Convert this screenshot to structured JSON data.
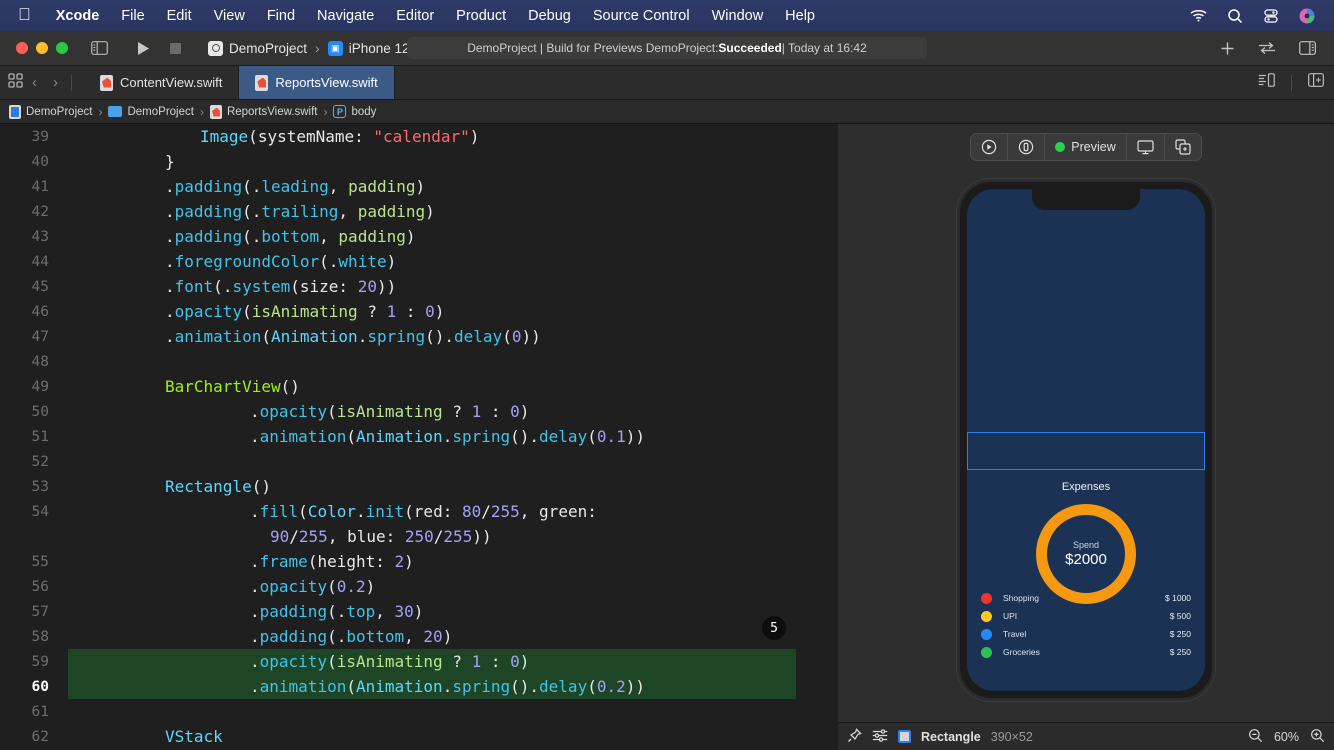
{
  "menubar": {
    "apple_icon": "apple-logo-icon",
    "items": [
      {
        "label": "Xcode",
        "bold": true
      },
      {
        "label": "File",
        "bold": false
      },
      {
        "label": "Edit",
        "bold": false
      },
      {
        "label": "View",
        "bold": false
      },
      {
        "label": "Find",
        "bold": false
      },
      {
        "label": "Navigate",
        "bold": false
      },
      {
        "label": "Editor",
        "bold": false
      },
      {
        "label": "Product",
        "bold": false
      },
      {
        "label": "Debug",
        "bold": false
      },
      {
        "label": "Source Control",
        "bold": false
      },
      {
        "label": "Window",
        "bold": false
      },
      {
        "label": "Help",
        "bold": false
      }
    ],
    "status_icons": [
      "wifi-icon",
      "search-icon",
      "control-center-icon",
      "user-avatar-icon"
    ],
    "accent": "#2e3a68"
  },
  "toolbar": {
    "traffic_lights": [
      "close-button",
      "minimize-button",
      "zoom-button"
    ],
    "sidebar_toggle": "toggle-navigator-icon",
    "run_button": "run-icon",
    "stop_button": "stop-icon",
    "scheme_project": "DemoProject",
    "scheme_separator": "›",
    "scheme_device": "iPhone 12",
    "status": {
      "prefix": "DemoProject | Build for Previews DemoProject: ",
      "result": "Succeeded",
      "suffix": " | Today at 16:42"
    },
    "add_button": "plus-icon",
    "history_button": "code-review-icon",
    "inspector_toggle": "toggle-inspector-icon"
  },
  "tabbar": {
    "grid_icon": "tab-grid-icon",
    "back_arrow": "‹",
    "forward_arrow": "›",
    "tabs": [
      {
        "label": "ContentView.swift",
        "active": false,
        "icon": "swift-file-icon"
      },
      {
        "label": "ReportsView.swift",
        "active": true,
        "icon": "swift-file-icon"
      }
    ],
    "right_icons": [
      "minimap-icon",
      "add-editor-icon"
    ]
  },
  "breadcrumb": {
    "items": [
      {
        "label": "DemoProject",
        "icon": "xcode-project-icon"
      },
      {
        "label": "DemoProject",
        "icon": "folder-icon"
      },
      {
        "label": "ReportsView.swift",
        "icon": "swift-file-icon"
      },
      {
        "label": "body",
        "icon": "property-icon"
      }
    ],
    "separator": "›"
  },
  "editor": {
    "marker_badge": "5",
    "highlight_color": "#1d4526",
    "lines": [
      {
        "num": "39",
        "indent": 0,
        "tokens": [
          {
            "t": "Image",
            "c": "t"
          },
          {
            "t": "(",
            "c": "p"
          },
          {
            "t": "systemName",
            "c": "p"
          },
          {
            "t": ": ",
            "c": "p"
          },
          {
            "t": "\"calendar\"",
            "c": "s"
          },
          {
            "t": ")",
            "c": "p"
          }
        ],
        "hl": false
      },
      {
        "num": "40",
        "indent": 0,
        "tokens": [
          {
            "t": "}",
            "c": "p"
          }
        ],
        "hl": false,
        "dedent": true
      },
      {
        "num": "41",
        "indent": 0,
        "tokens": [
          {
            "t": ".",
            "c": "p"
          },
          {
            "t": "padding",
            "c": "f"
          },
          {
            "t": "(",
            "c": "p"
          },
          {
            "t": ".",
            "c": "p"
          },
          {
            "t": "leading",
            "c": "f"
          },
          {
            "t": ", ",
            "c": "p"
          },
          {
            "t": "padding",
            "c": "v"
          },
          {
            "t": ")",
            "c": "p"
          }
        ],
        "hl": false,
        "dedent": true
      },
      {
        "num": "42",
        "indent": 0,
        "tokens": [
          {
            "t": ".",
            "c": "p"
          },
          {
            "t": "padding",
            "c": "f"
          },
          {
            "t": "(",
            "c": "p"
          },
          {
            "t": ".",
            "c": "p"
          },
          {
            "t": "trailing",
            "c": "f"
          },
          {
            "t": ", ",
            "c": "p"
          },
          {
            "t": "padding",
            "c": "v"
          },
          {
            "t": ")",
            "c": "p"
          }
        ],
        "hl": false,
        "dedent": true
      },
      {
        "num": "43",
        "indent": 0,
        "tokens": [
          {
            "t": ".",
            "c": "p"
          },
          {
            "t": "padding",
            "c": "f"
          },
          {
            "t": "(",
            "c": "p"
          },
          {
            "t": ".",
            "c": "p"
          },
          {
            "t": "bottom",
            "c": "f"
          },
          {
            "t": ", ",
            "c": "p"
          },
          {
            "t": "padding",
            "c": "v"
          },
          {
            "t": ")",
            "c": "p"
          }
        ],
        "hl": false,
        "dedent": true
      },
      {
        "num": "44",
        "indent": 0,
        "tokens": [
          {
            "t": ".",
            "c": "p"
          },
          {
            "t": "foregroundColor",
            "c": "f"
          },
          {
            "t": "(",
            "c": "p"
          },
          {
            "t": ".",
            "c": "p"
          },
          {
            "t": "white",
            "c": "f"
          },
          {
            "t": ")",
            "c": "p"
          }
        ],
        "hl": false,
        "dedent": true
      },
      {
        "num": "45",
        "indent": 0,
        "tokens": [
          {
            "t": ".",
            "c": "p"
          },
          {
            "t": "font",
            "c": "f"
          },
          {
            "t": "(",
            "c": "p"
          },
          {
            "t": ".",
            "c": "p"
          },
          {
            "t": "system",
            "c": "f"
          },
          {
            "t": "(",
            "c": "p"
          },
          {
            "t": "size",
            "c": "p"
          },
          {
            "t": ": ",
            "c": "p"
          },
          {
            "t": "20",
            "c": "n"
          },
          {
            "t": "))",
            "c": "p"
          }
        ],
        "hl": false,
        "dedent": true
      },
      {
        "num": "46",
        "indent": 0,
        "tokens": [
          {
            "t": ".",
            "c": "p"
          },
          {
            "t": "opacity",
            "c": "f"
          },
          {
            "t": "(",
            "c": "p"
          },
          {
            "t": "isAnimating",
            "c": "v"
          },
          {
            "t": " ? ",
            "c": "p"
          },
          {
            "t": "1",
            "c": "n"
          },
          {
            "t": " : ",
            "c": "p"
          },
          {
            "t": "0",
            "c": "n"
          },
          {
            "t": ")",
            "c": "p"
          }
        ],
        "hl": false,
        "dedent": true
      },
      {
        "num": "47",
        "indent": 0,
        "tokens": [
          {
            "t": ".",
            "c": "p"
          },
          {
            "t": "animation",
            "c": "f"
          },
          {
            "t": "(",
            "c": "p"
          },
          {
            "t": "Animation",
            "c": "t"
          },
          {
            "t": ".",
            "c": "p"
          },
          {
            "t": "spring",
            "c": "f"
          },
          {
            "t": "().",
            "c": "p"
          },
          {
            "t": "delay",
            "c": "f"
          },
          {
            "t": "(",
            "c": "p"
          },
          {
            "t": "0",
            "c": "n"
          },
          {
            "t": "))",
            "c": "p"
          }
        ],
        "hl": false,
        "dedent": true
      },
      {
        "num": "48",
        "indent": 0,
        "tokens": [],
        "hl": false
      },
      {
        "num": "49",
        "indent": 0,
        "tokens": [
          {
            "t": "BarChartView",
            "c": "ut"
          },
          {
            "t": "()",
            "c": "p"
          }
        ],
        "hl": false,
        "dedent": true
      },
      {
        "num": "50",
        "indent": 1,
        "tokens": [
          {
            "t": ".",
            "c": "p"
          },
          {
            "t": "opacity",
            "c": "f"
          },
          {
            "t": "(",
            "c": "p"
          },
          {
            "t": "isAnimating",
            "c": "v"
          },
          {
            "t": " ? ",
            "c": "p"
          },
          {
            "t": "1",
            "c": "n"
          },
          {
            "t": " : ",
            "c": "p"
          },
          {
            "t": "0",
            "c": "n"
          },
          {
            "t": ")",
            "c": "p"
          }
        ],
        "hl": false
      },
      {
        "num": "51",
        "indent": 1,
        "tokens": [
          {
            "t": ".",
            "c": "p"
          },
          {
            "t": "animation",
            "c": "f"
          },
          {
            "t": "(",
            "c": "p"
          },
          {
            "t": "Animation",
            "c": "t"
          },
          {
            "t": ".",
            "c": "p"
          },
          {
            "t": "spring",
            "c": "f"
          },
          {
            "t": "().",
            "c": "p"
          },
          {
            "t": "delay",
            "c": "f"
          },
          {
            "t": "(",
            "c": "p"
          },
          {
            "t": "0.1",
            "c": "n"
          },
          {
            "t": "))",
            "c": "p"
          }
        ],
        "hl": false
      },
      {
        "num": "52",
        "indent": 0,
        "tokens": [],
        "hl": false
      },
      {
        "num": "53",
        "indent": 0,
        "tokens": [
          {
            "t": "Rectangle",
            "c": "t"
          },
          {
            "t": "()",
            "c": "p"
          }
        ],
        "hl": false,
        "dedent": true
      },
      {
        "num": "54",
        "indent": 1,
        "tokens": [
          {
            "t": ".",
            "c": "p"
          },
          {
            "t": "fill",
            "c": "f"
          },
          {
            "t": "(",
            "c": "p"
          },
          {
            "t": "Color",
            "c": "t"
          },
          {
            "t": ".",
            "c": "p"
          },
          {
            "t": "init",
            "c": "f"
          },
          {
            "t": "(",
            "c": "p"
          },
          {
            "t": "red",
            "c": "p"
          },
          {
            "t": ": ",
            "c": "p"
          },
          {
            "t": "80",
            "c": "n"
          },
          {
            "t": "/",
            "c": "p"
          },
          {
            "t": "255",
            "c": "n"
          },
          {
            "t": ", ",
            "c": "p"
          },
          {
            "t": "green",
            "c": "p"
          },
          {
            "t": ":",
            "c": "p"
          }
        ],
        "hl": false
      },
      {
        "num": "",
        "indent": 2,
        "tokens": [
          {
            "t": "90",
            "c": "n"
          },
          {
            "t": "/",
            "c": "p"
          },
          {
            "t": "255",
            "c": "n"
          },
          {
            "t": ", ",
            "c": "p"
          },
          {
            "t": "blue",
            "c": "p"
          },
          {
            "t": ": ",
            "c": "p"
          },
          {
            "t": "250",
            "c": "n"
          },
          {
            "t": "/",
            "c": "p"
          },
          {
            "t": "255",
            "c": "n"
          },
          {
            "t": "))",
            "c": "p"
          }
        ],
        "hl": false,
        "wrap": true
      },
      {
        "num": "55",
        "indent": 1,
        "tokens": [
          {
            "t": ".",
            "c": "p"
          },
          {
            "t": "frame",
            "c": "f"
          },
          {
            "t": "(",
            "c": "p"
          },
          {
            "t": "height",
            "c": "p"
          },
          {
            "t": ": ",
            "c": "p"
          },
          {
            "t": "2",
            "c": "n"
          },
          {
            "t": ")",
            "c": "p"
          }
        ],
        "hl": false
      },
      {
        "num": "56",
        "indent": 1,
        "tokens": [
          {
            "t": ".",
            "c": "p"
          },
          {
            "t": "opacity",
            "c": "f"
          },
          {
            "t": "(",
            "c": "p"
          },
          {
            "t": "0.2",
            "c": "n"
          },
          {
            "t": ")",
            "c": "p"
          }
        ],
        "hl": false
      },
      {
        "num": "57",
        "indent": 1,
        "tokens": [
          {
            "t": ".",
            "c": "p"
          },
          {
            "t": "padding",
            "c": "f"
          },
          {
            "t": "(",
            "c": "p"
          },
          {
            "t": ".",
            "c": "p"
          },
          {
            "t": "top",
            "c": "f"
          },
          {
            "t": ", ",
            "c": "p"
          },
          {
            "t": "30",
            "c": "n"
          },
          {
            "t": ")",
            "c": "p"
          }
        ],
        "hl": false
      },
      {
        "num": "58",
        "indent": 1,
        "tokens": [
          {
            "t": ".",
            "c": "p"
          },
          {
            "t": "padding",
            "c": "f"
          },
          {
            "t": "(",
            "c": "p"
          },
          {
            "t": ".",
            "c": "p"
          },
          {
            "t": "bottom",
            "c": "f"
          },
          {
            "t": ", ",
            "c": "p"
          },
          {
            "t": "20",
            "c": "n"
          },
          {
            "t": ")",
            "c": "p"
          }
        ],
        "hl": false,
        "badge": true
      },
      {
        "num": "59",
        "indent": 1,
        "tokens": [
          {
            "t": ".",
            "c": "p"
          },
          {
            "t": "opacity",
            "c": "f"
          },
          {
            "t": "(",
            "c": "p"
          },
          {
            "t": "isAnimating",
            "c": "v"
          },
          {
            "t": " ? ",
            "c": "p"
          },
          {
            "t": "1",
            "c": "n"
          },
          {
            "t": " : ",
            "c": "p"
          },
          {
            "t": "0",
            "c": "n"
          },
          {
            "t": ")",
            "c": "p"
          }
        ],
        "hl": true
      },
      {
        "num": "60",
        "indent": 1,
        "tokens": [
          {
            "t": ".",
            "c": "p"
          },
          {
            "t": "animation",
            "c": "f"
          },
          {
            "t": "(",
            "c": "p"
          },
          {
            "t": "Animation",
            "c": "t"
          },
          {
            "t": ".",
            "c": "p"
          },
          {
            "t": "spring",
            "c": "f"
          },
          {
            "t": "().",
            "c": "p"
          },
          {
            "t": "delay",
            "c": "f"
          },
          {
            "t": "(",
            "c": "p"
          },
          {
            "t": "0.2",
            "c": "n"
          },
          {
            "t": "))",
            "c": "p"
          }
        ],
        "hl": true,
        "current": true
      },
      {
        "num": "61",
        "indent": 0,
        "tokens": [],
        "hl": false
      },
      {
        "num": "62",
        "indent": 0,
        "tokens": [
          {
            "t": "VStack",
            "c": "t"
          }
        ],
        "hl": false,
        "dedent": true
      }
    ]
  },
  "preview": {
    "toolbar": {
      "live_preview_icon": "live-preview-play-icon",
      "device_settings_icon": "device-settings-icon",
      "status_label": "Preview",
      "status_color": "#2fd04f",
      "display_icon": "display-icon",
      "duplicate_icon": "duplicate-preview-icon"
    },
    "device": "iPhone 12",
    "screen": {
      "background": "#1b3255",
      "selection_color": "#2c7ef8",
      "title": "Expenses",
      "donut": {
        "color": "#f59a10",
        "label": "Spend",
        "amount": "$2000"
      },
      "legend": [
        {
          "label": "Shopping",
          "amount": "$ 1000",
          "color": "#f5332b"
        },
        {
          "label": "UPI",
          "amount": "$ 500",
          "color": "#ffc81f"
        },
        {
          "label": "Travel",
          "amount": "$ 250",
          "color": "#1f8bff"
        },
        {
          "label": "Groceries",
          "amount": "$ 250",
          "color": "#2ec24f"
        }
      ]
    }
  },
  "canvas_bar": {
    "pin_icon": "pin-icon",
    "variants_icon": "variants-icon",
    "selected_swatch_color": "#2c7ef8",
    "selected_name": "Rectangle",
    "selected_size": "390×52",
    "zoom_out_icon": "zoom-out-icon",
    "zoom_level": "60%",
    "zoom_in_icon": "zoom-in-icon"
  }
}
